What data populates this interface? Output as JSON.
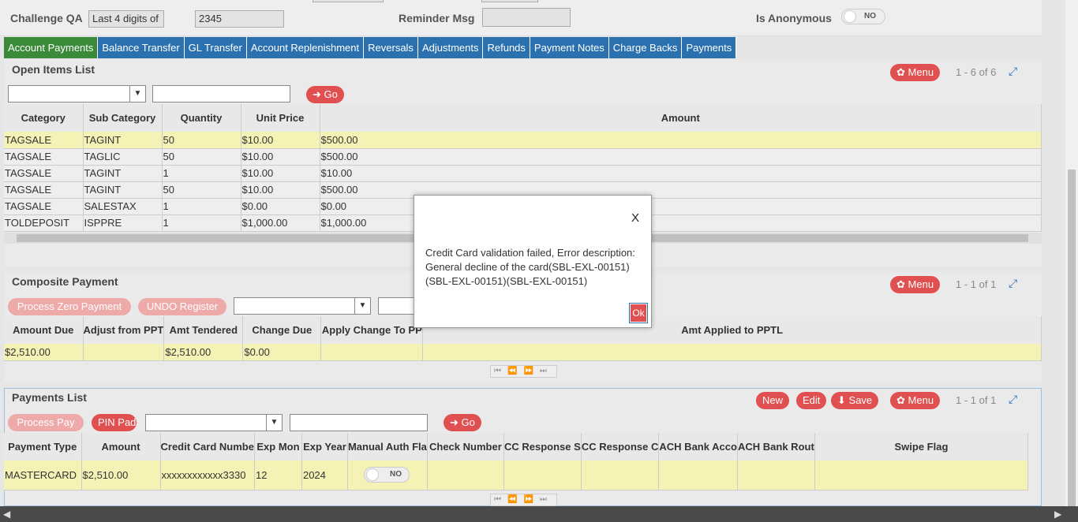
{
  "top": {
    "challenge_label": "Challenge QA",
    "challenge_value": "Last 4 digits of",
    "challenge_answer": "2345",
    "reminder_label": "Reminder Msg",
    "anonymous_label": "Is Anonymous",
    "anonymous_toggle": "NO"
  },
  "tabs": [
    "Account Payments",
    "Balance Transfer",
    "GL Transfer",
    "Account Replenishment",
    "Reversals",
    "Adjustments",
    "Refunds",
    "Payment Notes",
    "Charge Backs",
    "Payments"
  ],
  "open_items": {
    "title": "Open Items List",
    "menu": "Menu",
    "count": "1 - 6 of 6",
    "go": "Go",
    "columns": [
      "Category",
      "Sub Category",
      "Quantity",
      "Unit Price",
      "Amount"
    ],
    "rows": [
      [
        "TAGSALE",
        "TAGINT",
        "50",
        "$10.00",
        "$500.00"
      ],
      [
        "TAGSALE",
        "TAGLIC",
        "50",
        "$10.00",
        "$500.00"
      ],
      [
        "TAGSALE",
        "TAGINT",
        "1",
        "$10.00",
        "$10.00"
      ],
      [
        "TAGSALE",
        "TAGINT",
        "50",
        "$10.00",
        "$500.00"
      ],
      [
        "TAGSALE",
        "SALESTAX",
        "1",
        "$0.00",
        "$0.00"
      ],
      [
        "TOLDEPOSIT",
        "ISPPRE",
        "1",
        "$1,000.00",
        "$1,000.00"
      ]
    ]
  },
  "composite": {
    "title": "Composite Payment",
    "menu": "Menu",
    "count": "1 - 1 of 1",
    "process_zero": "Process Zero Payment",
    "undo_register": "UNDO Register",
    "columns": [
      "Amount Due",
      "Adjust from PPT",
      "Amt Tendered",
      "Change Due",
      "Apply Change To PP",
      "Amt Applied to PPTL"
    ],
    "rows": [
      [
        "$2,510.00",
        "",
        "$2,510.00",
        "$0.00",
        "",
        ""
      ]
    ]
  },
  "payments": {
    "title": "Payments List",
    "new": "New",
    "edit": "Edit",
    "save": "Save",
    "menu": "Menu",
    "count": "1 - 1 of 1",
    "process_pay": "Process Pay",
    "pin_pad": "PIN Pad",
    "go": "Go",
    "columns": [
      "Payment Type",
      "Amount",
      "Credit Card Numbe",
      "Exp Mon",
      "Exp Year",
      "Manual Auth Fla",
      "Check Number",
      "CC Response S",
      "CC Response C",
      "ACH Bank Acco",
      "ACH Bank Rout",
      "Swipe Flag"
    ],
    "row": [
      "MASTERCARD",
      "$2,510.00",
      "xxxxxxxxxxxx3330",
      "12",
      "2024",
      "",
      "",
      "",
      "",
      "",
      "",
      ""
    ],
    "manual_auth_toggle": "NO"
  },
  "modal": {
    "close": "X",
    "message": "Credit Card validation failed, Error description: General decline of the card(SBL-EXL-00151)(SBL-EXL-00151)(SBL-EXL-00151)",
    "ok": "Ok"
  },
  "colors": {
    "tab": "#2b71b0",
    "tab_active": "#3a8a3a",
    "button": "#e05050",
    "selected_row": "#f4f2b4"
  }
}
